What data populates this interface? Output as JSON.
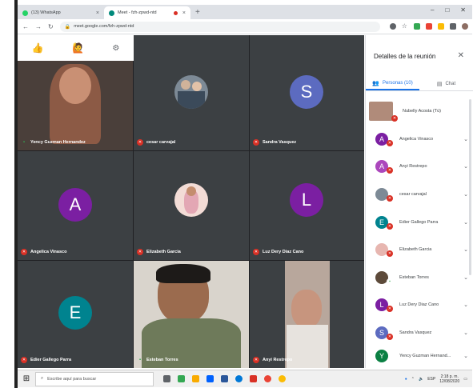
{
  "browser": {
    "tabs": [
      {
        "title": "(13) WhatsApp",
        "fav_color": "#25d366"
      },
      {
        "title": "Meet - fzh-zpwd-ntd",
        "fav_color": "#00897b"
      }
    ],
    "url": "meet.google.com/fzh-zpwd-ntd",
    "window_controls": [
      "–",
      "□",
      "✕"
    ]
  },
  "reactions": [
    "👍",
    "🙋",
    "⚙"
  ],
  "tiles": [
    {
      "name": "Yency Guzman Hernandez",
      "kind": "video",
      "mic": "live"
    },
    {
      "name": "cesar carvajal",
      "kind": "photo",
      "mic": "muted"
    },
    {
      "name": "Sandra Vasquez",
      "kind": "letter",
      "letter": "S",
      "color": "#5c6bc0",
      "mic": "muted"
    },
    {
      "name": "Angelica Vinasco",
      "kind": "letter",
      "letter": "A",
      "color": "#7b1fa2",
      "mic": "muted"
    },
    {
      "name": "Elizabeth Garcia",
      "kind": "photo",
      "mic": "muted"
    },
    {
      "name": "Luz Dery Diaz Cano",
      "kind": "letter",
      "letter": "L",
      "color": "#7b1fa2",
      "mic": "muted"
    },
    {
      "name": "Edier Gallego Parra",
      "kind": "letter",
      "letter": "E",
      "color": "#00838f",
      "mic": "muted"
    },
    {
      "name": "Esteban Torres",
      "kind": "video",
      "mic": "live"
    },
    {
      "name": "Anyi Restrepo",
      "kind": "video",
      "mic": "muted"
    }
  ],
  "panel": {
    "title": "Detalles de la reunión",
    "tab_people": "Personas (10)",
    "tab_chat": "Chat",
    "people": [
      {
        "name": "Nubelly Acosta (Tú)",
        "letter": "",
        "color": "#b08b7a",
        "mic": "muted"
      },
      {
        "name": "Angelica Vinasco",
        "letter": "A",
        "color": "#7b1fa2",
        "mic": "muted"
      },
      {
        "name": "Anyi Restrepo",
        "letter": "A",
        "color": "#ab47bc",
        "mic": "muted"
      },
      {
        "name": "cesar carvajal",
        "letter": "",
        "color": "#7d8a96",
        "mic": "muted"
      },
      {
        "name": "Edier Gallego Parra",
        "letter": "E",
        "color": "#00838f",
        "mic": "muted"
      },
      {
        "name": "Elizabeth Garcia",
        "letter": "",
        "color": "#e7b6b0",
        "mic": "muted"
      },
      {
        "name": "Esteban Torres",
        "letter": "",
        "color": "#5d4a3a",
        "mic": "live"
      },
      {
        "name": "Luz Dery Diaz Cano",
        "letter": "L",
        "color": "#7b1fa2",
        "mic": "muted"
      },
      {
        "name": "Sandra Vasquez",
        "letter": "S",
        "color": "#5c6bc0",
        "mic": "muted"
      },
      {
        "name": "Yency Guzman Hernand...",
        "letter": "Y",
        "color": "#0b8043",
        "mic": "muted"
      }
    ]
  },
  "taskbar": {
    "search_placeholder": "Escribe aquí para buscar",
    "lang": "ESP",
    "time": "2:18 p. m.",
    "date": "12/08/2020"
  }
}
